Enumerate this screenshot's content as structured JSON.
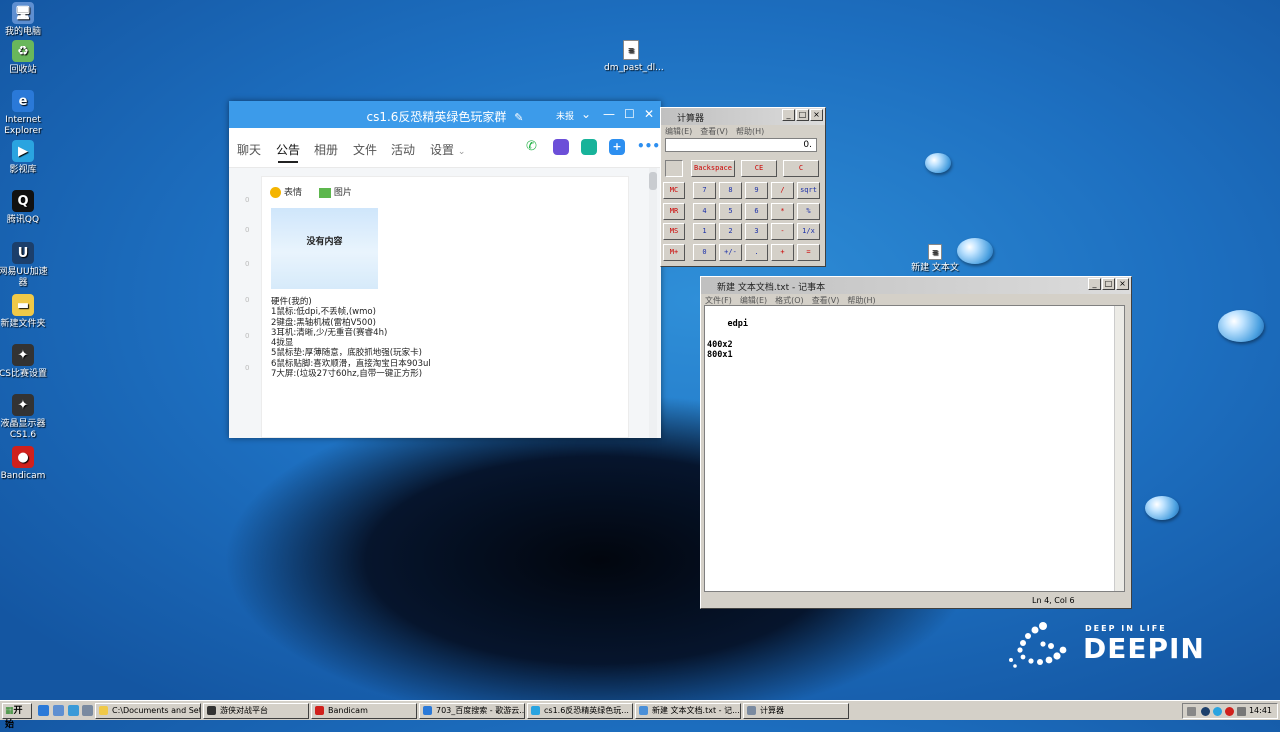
{
  "desktop": {
    "icons": [
      {
        "label": "我的电脑",
        "glyph": "🖥",
        "color": "#5e8fd1"
      },
      {
        "label": "回收站",
        "glyph": "♻",
        "color": "#69b75b"
      },
      {
        "label": "Internet Explorer",
        "glyph": "e",
        "color": "#2a79d8"
      },
      {
        "label": "影视库",
        "glyph": "▶",
        "color": "#2aa4e0"
      },
      {
        "label": "腾讯QQ",
        "glyph": "Q",
        "color": "#111111"
      },
      {
        "label": "网易UU加速器",
        "glyph": "U",
        "color": "#1c3f6b"
      },
      {
        "label": "新建文件夹",
        "glyph": "▬",
        "color": "#f0c948"
      },
      {
        "label": "CS比赛设置",
        "glyph": "✦",
        "color": "#333333"
      },
      {
        "label": "液晶显示器CS1.6",
        "glyph": "✦",
        "color": "#333333"
      },
      {
        "label": "Bandicam",
        "glyph": "●",
        "color": "#d0201c"
      }
    ],
    "file_icon_1": "dm_past_dl...",
    "file_icon_2": "新建 文本文",
    "logo_tag": "DEEP IN LIFE",
    "logo_word": "DEEPIN"
  },
  "qq": {
    "title": "cs1.6反恐精英绿色玩家群",
    "title_extra": "未报",
    "tabs": [
      "聊天",
      "公告",
      "相册",
      "文件",
      "活动",
      "设置"
    ],
    "active_tab": "公告",
    "toolbar_emoji": "表情",
    "toolbar_image": "图片",
    "image_placeholder": "没有内容",
    "lines": [
      "硬件(我的)",
      "1鼠标:低dpi,不丢帧,(wmo)",
      "2键盘:黑轴机械(雷柏V500)",
      "3耳机:清晰,少/无重音(赛睿4h)",
      "4拢显",
      "5鼠标垫:厚薄随意，底胶抓地强(玩家卡)",
      "6鼠标贴脚:喜欢顺滑，直接淘宝日本903ul",
      "7大屏:(垃圾27寸60hz,自带一键正方形)"
    ],
    "icon_colors": {
      "phone": "#27b34a",
      "video": "#6c4fd8",
      "app": "#18b39a",
      "add": "#2d8ff0",
      "more": "#2d8ff0"
    }
  },
  "calculator": {
    "title": "计算器",
    "menu": [
      "编辑(E)",
      "查看(V)",
      "帮助(H)"
    ],
    "display": "0.",
    "top_buttons": [
      "Backspace",
      "CE",
      "C"
    ],
    "memory_buttons": [
      "MC",
      "MR",
      "MS",
      "M+"
    ],
    "grid": [
      [
        "7",
        "8",
        "9",
        "/",
        "sqrt"
      ],
      [
        "4",
        "5",
        "6",
        "*",
        "%"
      ],
      [
        "1",
        "2",
        "3",
        "-",
        "1/x"
      ],
      [
        "0",
        "+/-",
        ".",
        "+",
        "="
      ]
    ]
  },
  "notepad": {
    "title": "新建 文本文档.txt - 记事本",
    "menu": [
      "文件(F)",
      "编辑(E)",
      "格式(O)",
      "查看(V)",
      "帮助(H)"
    ],
    "content": "edpi\n\n400x2\n800x1",
    "status": "Ln 4, Col 6"
  },
  "taskbar": {
    "start": "开始",
    "tasks": [
      {
        "label": "C:\\Documents and Settin...",
        "color": "#f0c948"
      },
      {
        "label": "游侠对战平台",
        "color": "#333333"
      },
      {
        "label": "Bandicam",
        "color": "#d0201c"
      },
      {
        "label": "703_百度搜索 - 歌游云...",
        "color": "#2a79d8"
      },
      {
        "label": "cs1.6反恐精英绿色玩...",
        "color": "#2aa4e0"
      },
      {
        "label": "新建 文本文档.txt - 记...",
        "color": "#4a8fd8"
      },
      {
        "label": "计算器",
        "color": "#7a8aa0"
      }
    ],
    "clock": "14:41"
  }
}
